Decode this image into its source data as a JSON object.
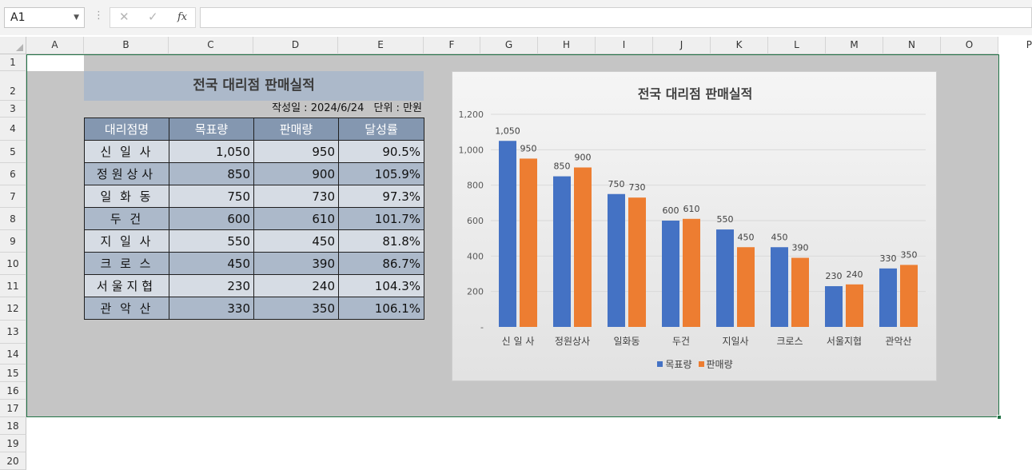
{
  "name_box": {
    "value": "A1"
  },
  "formula_bar": {
    "cancel_icon": "✕",
    "enter_icon": "✓",
    "fx_label": "fx",
    "value": ""
  },
  "columns": [
    "A",
    "B",
    "C",
    "D",
    "E",
    "F",
    "G",
    "H",
    "I",
    "J",
    "K",
    "L",
    "M",
    "N",
    "O",
    "P"
  ],
  "rows": [
    "1",
    "2",
    "3",
    "4",
    "5",
    "6",
    "7",
    "8",
    "9",
    "10",
    "11",
    "12",
    "13",
    "14",
    "15",
    "16",
    "17",
    "18",
    "19",
    "20"
  ],
  "sheet": {
    "title": "전국 대리점 판매실적",
    "created_label": "작성일 : 2024/6/24",
    "unit_label": "단위 : 만원",
    "table": {
      "headers": [
        "대리점명",
        "목표량",
        "판매량",
        "달성률"
      ],
      "rows": [
        {
          "name": "신 일 사",
          "target": "1,050",
          "sales": "950",
          "rate": "90.5%"
        },
        {
          "name": "정원상사",
          "target": "850",
          "sales": "900",
          "rate": "105.9%"
        },
        {
          "name": "일 화 동",
          "target": "750",
          "sales": "730",
          "rate": "97.3%"
        },
        {
          "name": "두 건",
          "target": "600",
          "sales": "610",
          "rate": "101.7%"
        },
        {
          "name": "지 일 사",
          "target": "550",
          "sales": "450",
          "rate": "81.8%"
        },
        {
          "name": "크 로 스",
          "target": "450",
          "sales": "390",
          "rate": "86.7%"
        },
        {
          "name": "서울지협",
          "target": "230",
          "sales": "240",
          "rate": "104.3%"
        },
        {
          "name": "관 악 산",
          "target": "330",
          "sales": "350",
          "rate": "106.1%"
        }
      ]
    }
  },
  "chart_data": {
    "type": "bar",
    "title": "전국 대리점 판매실적",
    "categories": [
      "신 일 사",
      "정원상사",
      "일화동",
      "두건",
      "지일사",
      "크로스",
      "서울지협",
      "관악산"
    ],
    "series": [
      {
        "name": "목표량",
        "values": [
          1050,
          850,
          750,
          600,
          550,
          450,
          230,
          330
        ],
        "color": "#4472c4"
      },
      {
        "name": "판매량",
        "values": [
          950,
          900,
          730,
          610,
          450,
          390,
          240,
          350
        ],
        "color": "#ed7d31"
      }
    ],
    "ylim": [
      0,
      1200
    ],
    "yticks": [
      0,
      200,
      400,
      600,
      800,
      1000,
      1200
    ],
    "ytick_labels": [
      "-",
      "200",
      "400",
      "600",
      "800",
      "1,000",
      "1,200"
    ],
    "data_labels": true,
    "legend": "bottom",
    "grid": true
  },
  "colors": {
    "header_fill": "#8497b0",
    "band_light": "#d6dce4",
    "band_dark": "#acb9ca",
    "selection_border": "#217346"
  }
}
